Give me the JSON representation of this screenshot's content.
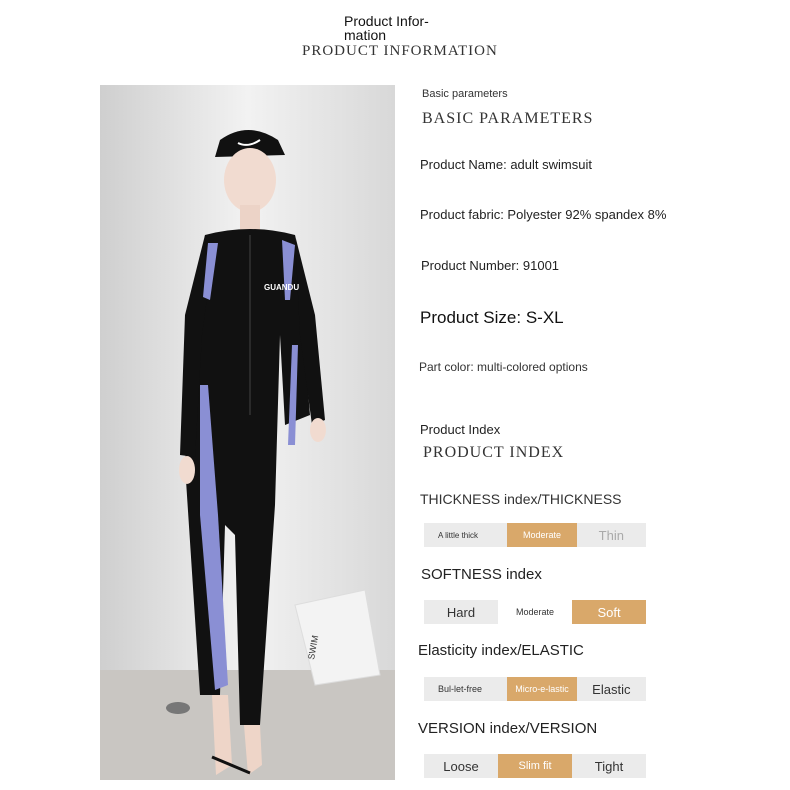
{
  "header": {
    "title_line1": "Product Infor-",
    "title_line2": "mation",
    "title_caps": "PRODUCT INFORMATION"
  },
  "photo": {
    "logo_text": "GUANDU",
    "bag_text": "SWIM"
  },
  "basic": {
    "heading_small": "Basic parameters",
    "heading_caps": "BASIC PARAMETERS",
    "name": "Product Name: adult swimsuit",
    "fabric": "Product fabric: Polyester 92% spandex 8%",
    "number": "Product Number: 91001",
    "size": "Product Size: S-XL",
    "color": "Part color: multi-colored options"
  },
  "index": {
    "heading_small": "Product Index",
    "heading_caps": "PRODUCT INDEX",
    "thickness": {
      "title": "THICKNESS index/THICKNESS",
      "options": [
        "A little thick",
        "Moderate",
        "Thin"
      ],
      "selected": 1
    },
    "softness": {
      "title": "SOFTNESS index",
      "options": [
        "Hard",
        "Moderate",
        "Soft"
      ],
      "selected": 2
    },
    "elasticity": {
      "title": "Elasticity index/ELASTIC",
      "options": [
        "Bul-let-free",
        "Micro-e-lastic",
        "Elastic"
      ],
      "selected": 1
    },
    "version": {
      "title": "VERSION index/VERSION",
      "options": [
        "Loose",
        "Slim fit",
        "Tight"
      ],
      "selected": 1
    }
  },
  "colors": {
    "accent": "#d9a86a",
    "bar_bg": "#ebebeb",
    "suit_black": "#111111",
    "suit_stripe": "#8a8fd4"
  }
}
